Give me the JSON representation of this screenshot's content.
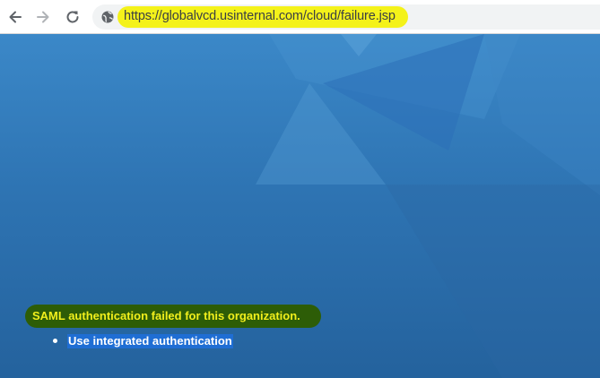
{
  "browser": {
    "url": "https://globalvcd.usinternal.com/cloud/failure.jsp"
  },
  "page": {
    "message": "SAML authentication failed for this organization.",
    "links": [
      "Use integrated authentication"
    ]
  },
  "colors": {
    "url_highlight": "#f4f21a",
    "message_highlight": "#2d5d07",
    "message_text": "#f1ef1c",
    "link_highlight": "#1f6ed4",
    "background": "#2e74b3"
  },
  "icons": [
    "back-arrow-icon",
    "forward-arrow-icon",
    "reload-icon",
    "globe-icon"
  ]
}
